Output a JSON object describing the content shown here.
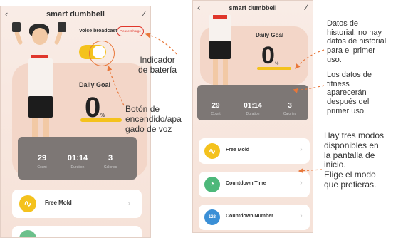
{
  "screen1": {
    "title": "smart dumbbell",
    "back_icon": "chevron-left-icon",
    "edit_icon": "pencil-icon",
    "voice_broadcast_label": "Voice broadcast",
    "please_charge": "Please Charge",
    "toggle_on": true,
    "daily_goal_label": "Daily Goal",
    "daily_goal_value": "0",
    "daily_goal_unit": "%",
    "stats": [
      {
        "value": "29",
        "label": "Count"
      },
      {
        "value": "01:14",
        "label": "Duration"
      },
      {
        "value": "3",
        "label": "Calories"
      }
    ],
    "modes": [
      {
        "label": "Free Mold",
        "icon": "pulse-icon",
        "color": "#f4c21d"
      },
      {
        "label": "",
        "icon": "timer-icon",
        "color": "#6cc08b"
      }
    ]
  },
  "screen2": {
    "title": "smart dumbbell",
    "back_icon": "chevron-left-icon",
    "edit_icon": "pencil-icon",
    "daily_goal_label": "Daily Goal",
    "daily_goal_value": "0",
    "daily_goal_unit": "%",
    "stats": [
      {
        "value": "29",
        "label": "Count"
      },
      {
        "value": "01:14",
        "label": "Duration"
      },
      {
        "value": "3",
        "label": "Calories"
      }
    ],
    "modes": [
      {
        "label": "Free Mold",
        "icon": "pulse-icon",
        "icon_text": "",
        "color": "#f4c21d"
      },
      {
        "label": "Countdown Time",
        "icon": "timer-icon",
        "icon_text": "",
        "color": "#4db87a"
      },
      {
        "label": "Countdown Number",
        "icon": "number-icon",
        "icon_text": "123",
        "color": "#3a8fd6"
      }
    ]
  },
  "annotations": {
    "battery": "Indicador\nde batería",
    "voice_switch": "Botón de\nencendido/apa\ngado de voz",
    "history": "Datos de\nhistorial: no hay\ndatos de historial\npara el primer\nuso.",
    "fitness": "Los datos de\nfitness\naparecerán\ndespués del\nprimer uso.",
    "modes": "Hay tres modos\ndisponibles en\nla pantalla de\ninicio.\nElige el modo\nque prefieras."
  },
  "colors": {
    "accent_yellow": "#f4c21d",
    "annotation_arrow": "#e8773a",
    "battery_red": "#e0362b"
  }
}
